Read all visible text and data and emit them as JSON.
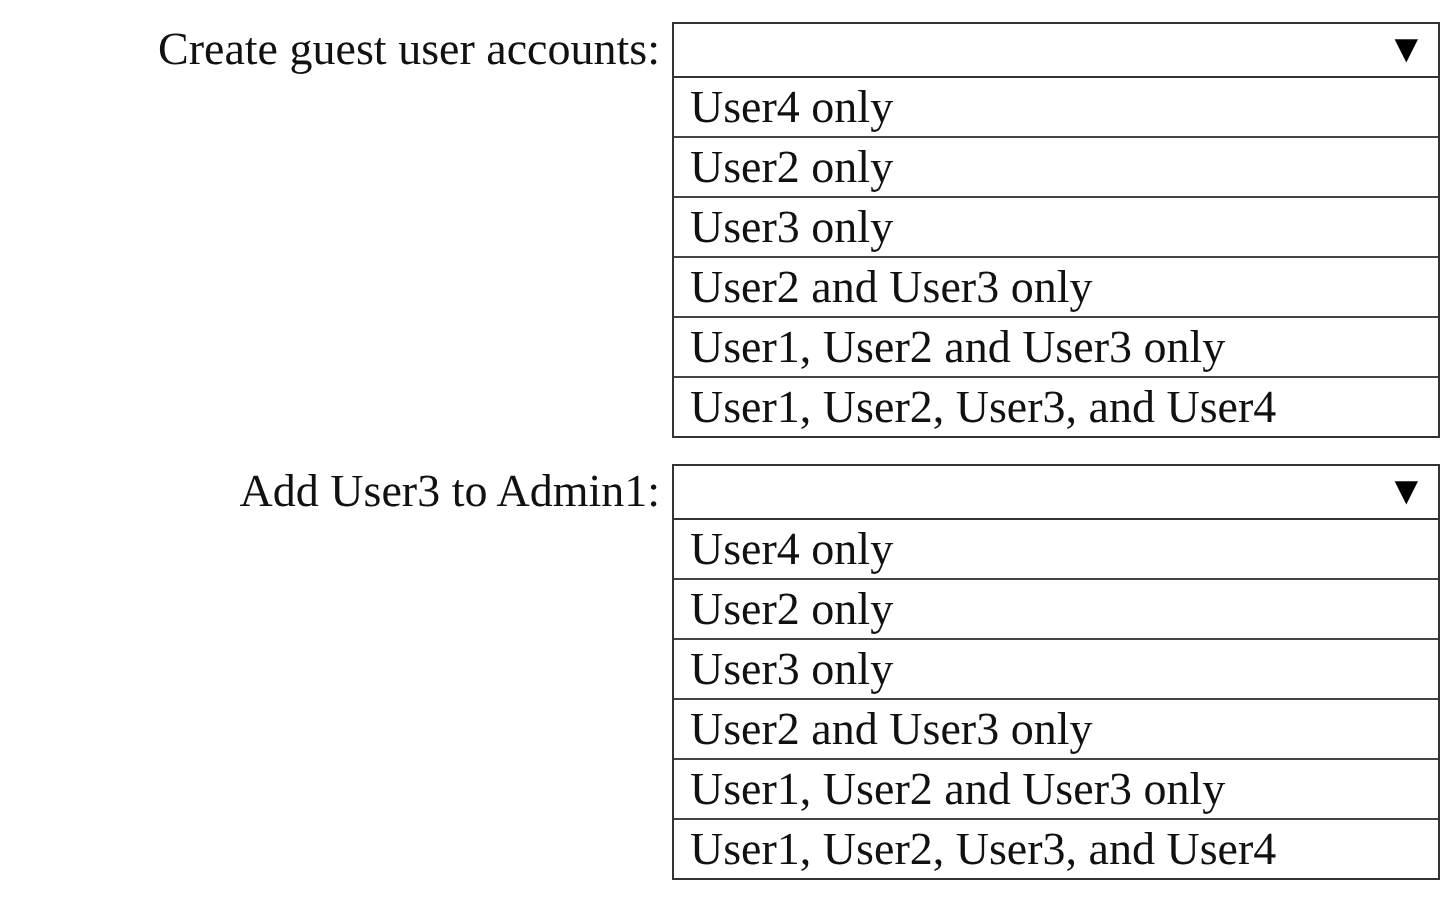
{
  "questions": [
    {
      "label": "Create guest user accounts:",
      "arrow": "▼",
      "options": [
        "User4 only",
        "User2 only",
        "User3 only",
        "User2 and User3 only",
        "User1, User2 and User3 only",
        "User1, User2, User3, and User4"
      ]
    },
    {
      "label": "Add User3 to Admin1:",
      "arrow": "▼",
      "options": [
        "User4 only",
        "User2 only",
        "User3 only",
        "User2 and User3 only",
        "User1, User2 and User3 only",
        "User1, User2, User3, and User4"
      ]
    }
  ]
}
